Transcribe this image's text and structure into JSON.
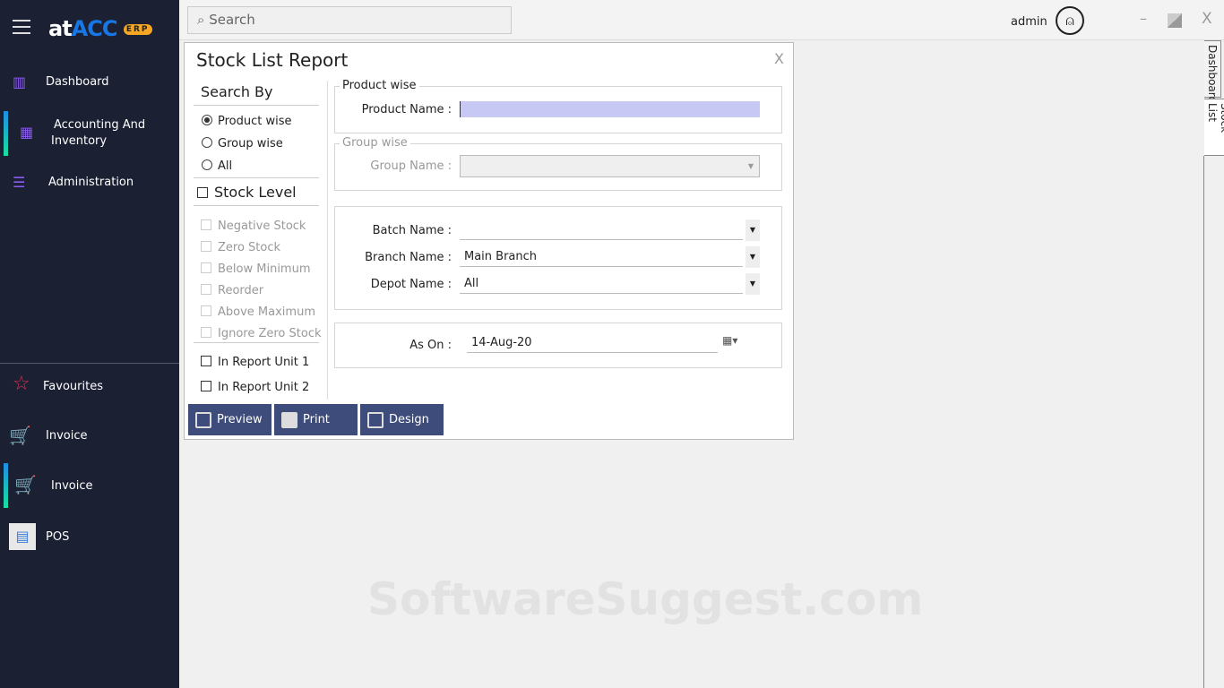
{
  "app": {
    "logo_main": "at",
    "logo_acc": "ACC",
    "logo_erp": "ERP"
  },
  "sidebar": {
    "items": [
      {
        "label": "Dashboard"
      },
      {
        "label": "Accounting And Inventory"
      },
      {
        "label": "Administration"
      }
    ],
    "bottom": [
      {
        "label": "Favourites"
      },
      {
        "label": "Invoice"
      },
      {
        "label": "Invoice"
      },
      {
        "label": "POS"
      }
    ]
  },
  "topbar": {
    "search_placeholder": "Search",
    "user": "admin",
    "minimize": "–",
    "close": "X"
  },
  "side_tabs": [
    "Dashboard",
    "Stock List"
  ],
  "dialog": {
    "title": "Stock List Report",
    "close": "X",
    "search_by": {
      "heading": "Search By",
      "options": [
        "Product wise",
        "Group wise",
        "All"
      ],
      "selected": "Product wise"
    },
    "stock_level": {
      "label": "Stock Level",
      "options": [
        "Negative Stock",
        "Zero Stock",
        "Below Minimum",
        "Reorder",
        "Above Maximum",
        "Ignore Zero Stock"
      ]
    },
    "report_units": [
      "In Report Unit 1",
      "In Report Unit 2"
    ],
    "product_wise": {
      "legend": "Product wise",
      "label": "Product Name :",
      "value": ""
    },
    "group_wise": {
      "legend": "Group wise",
      "label": "Group Name :",
      "value": ""
    },
    "batch": {
      "label": "Batch Name :",
      "value": ""
    },
    "branch": {
      "label": "Branch Name :",
      "value": "Main Branch"
    },
    "depot": {
      "label": "Depot Name :",
      "value": "All"
    },
    "as_on": {
      "label": "As On :",
      "value": "14-Aug-20"
    },
    "buttons": {
      "preview": "Preview",
      "print": "Print",
      "design": "Design"
    }
  },
  "watermark": "SoftwareSuggest.com"
}
